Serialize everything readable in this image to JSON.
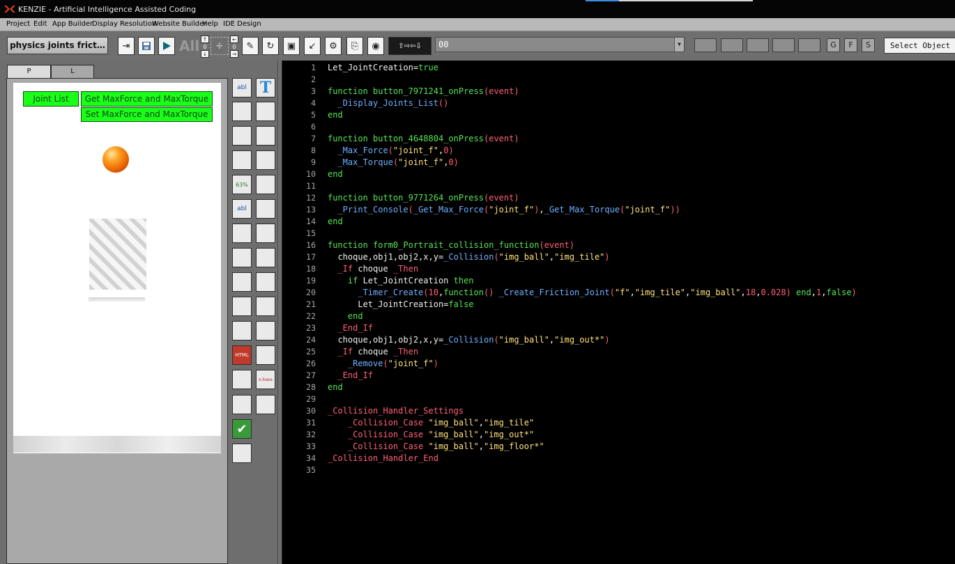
{
  "app": {
    "title": "KENZIE - Artificial Intelligence Assisted Coding"
  },
  "menu": [
    "Project",
    "Edit",
    "App Builder",
    "Display Resolution",
    "Website Builder",
    "Help",
    "IDE Design"
  ],
  "toolbar": {
    "project_button": "physics joints frict…",
    "all_label": "All",
    "mini_numbers": [
      "0",
      "0"
    ],
    "combo_value": "00",
    "letter_buttons": [
      "G",
      "F",
      "S"
    ],
    "select_object": "Select Object"
  },
  "left_panel": {
    "tabs": [
      "P",
      "L"
    ],
    "canvas_buttons": {
      "joint_list": "Joint List",
      "get_max": "Get MaxForce and MaxTorque",
      "set_max": "Set MaxForce and MaxTorque"
    },
    "palette": [
      {
        "icon": "label-icon",
        "glyph": "abl"
      },
      {
        "icon": "text-icon",
        "glyph": "T"
      },
      {
        "icon": "image-icon",
        "glyph": ""
      },
      {
        "icon": "button-icon",
        "glyph": ""
      },
      {
        "icon": "image-animation-icon",
        "glyph": ""
      },
      {
        "icon": "image-rotate-icon",
        "glyph": ""
      },
      {
        "icon": "list-icon",
        "glyph": ""
      },
      {
        "icon": "collision-icon",
        "glyph": ""
      },
      {
        "icon": "progress-icon",
        "glyph": "63%"
      },
      {
        "icon": "resize-icon",
        "glyph": ""
      },
      {
        "icon": "textbox-icon",
        "glyph": "abl"
      },
      {
        "icon": "move-icon",
        "glyph": ""
      },
      {
        "icon": "input-icon",
        "glyph": ""
      },
      {
        "icon": "shape-icon",
        "glyph": ""
      },
      {
        "icon": "slider-icon",
        "glyph": ""
      },
      {
        "icon": "joint-icon",
        "glyph": ""
      },
      {
        "icon": "particles-icon",
        "glyph": ""
      },
      {
        "icon": "physics-icon",
        "glyph": ""
      },
      {
        "icon": "spinner-icon",
        "glyph": ""
      },
      {
        "icon": "pivot-icon",
        "glyph": ""
      },
      {
        "icon": "toggle-icon",
        "glyph": ""
      },
      {
        "icon": "rope-icon",
        "glyph": ""
      },
      {
        "icon": "html-icon",
        "glyph": "HTML"
      },
      {
        "icon": "web-icon",
        "glyph": ""
      },
      {
        "icon": "map-icon",
        "glyph": ""
      },
      {
        "icon": "notes-icon",
        "glyph": "x-base"
      },
      {
        "icon": "radio-icon",
        "glyph": ""
      },
      {
        "icon": "timer-icon",
        "glyph": ""
      },
      {
        "icon": "checkbox-icon",
        "glyph": "✔"
      },
      {
        "icon": "video-icon",
        "glyph": ""
      }
    ]
  },
  "editor": {
    "lines": [
      {
        "n": "1",
        "tokens": [
          [
            "id",
            "Let_JointCreation"
          ],
          [
            "op",
            "="
          ],
          [
            "kw",
            "true"
          ]
        ]
      },
      {
        "n": "2",
        "tokens": []
      },
      {
        "n": "3",
        "tokens": [
          [
            "kw",
            "function "
          ],
          [
            "fn",
            "button_7971241_onPress"
          ],
          [
            "br",
            "("
          ],
          [
            "nm",
            "event"
          ],
          [
            "br",
            ")"
          ]
        ]
      },
      {
        "n": "4",
        "tokens": [
          [
            "op",
            "  "
          ],
          [
            "cl",
            "_Display_Joints_List"
          ],
          [
            "br",
            "()"
          ]
        ]
      },
      {
        "n": "5",
        "tokens": [
          [
            "kw",
            "end"
          ]
        ]
      },
      {
        "n": "6",
        "tokens": []
      },
      {
        "n": "7",
        "tokens": [
          [
            "kw",
            "function "
          ],
          [
            "fn",
            "button_4648804_onPress"
          ],
          [
            "br",
            "("
          ],
          [
            "nm",
            "event"
          ],
          [
            "br",
            ")"
          ]
        ]
      },
      {
        "n": "8",
        "tokens": [
          [
            "op",
            "  "
          ],
          [
            "cl",
            "_Max_Force"
          ],
          [
            "br",
            "("
          ],
          [
            "lt",
            "\"joint_f\""
          ],
          [
            "op",
            ","
          ],
          [
            "nm",
            "0"
          ],
          [
            "br",
            ")"
          ]
        ]
      },
      {
        "n": "9",
        "tokens": [
          [
            "op",
            "  "
          ],
          [
            "cl",
            "_Max_Torque"
          ],
          [
            "br",
            "("
          ],
          [
            "lt",
            "\"joint_f\""
          ],
          [
            "op",
            ","
          ],
          [
            "nm",
            "0"
          ],
          [
            "br",
            ")"
          ]
        ]
      },
      {
        "n": "10",
        "tokens": [
          [
            "kw",
            "end"
          ]
        ]
      },
      {
        "n": "11",
        "tokens": []
      },
      {
        "n": "12",
        "tokens": [
          [
            "kw",
            "function "
          ],
          [
            "fn",
            "button_9771264_onPress"
          ],
          [
            "br",
            "("
          ],
          [
            "nm",
            "event"
          ],
          [
            "br",
            ")"
          ]
        ]
      },
      {
        "n": "13",
        "tokens": [
          [
            "op",
            "  "
          ],
          [
            "cl",
            "_Print_Console"
          ],
          [
            "br",
            "("
          ],
          [
            "cl",
            "_Get_Max_Force"
          ],
          [
            "br",
            "("
          ],
          [
            "lt",
            "\"joint_f\""
          ],
          [
            "br",
            ")"
          ],
          [
            "op",
            ","
          ],
          [
            "cl",
            "_Get_Max_Torque"
          ],
          [
            "br",
            "("
          ],
          [
            "lt",
            "\"joint_f\""
          ],
          [
            "br",
            "))"
          ]
        ]
      },
      {
        "n": "14",
        "tokens": [
          [
            "kw",
            "end"
          ]
        ]
      },
      {
        "n": "15",
        "tokens": []
      },
      {
        "n": "16",
        "tokens": [
          [
            "kw",
            "function "
          ],
          [
            "fn",
            "form0_Portrait_collision_function"
          ],
          [
            "br",
            "("
          ],
          [
            "nm",
            "event"
          ],
          [
            "br",
            ")"
          ]
        ]
      },
      {
        "n": "17",
        "tokens": [
          [
            "id",
            "  choque,obj1,obj2,x,y"
          ],
          [
            "op",
            "="
          ],
          [
            "cl",
            "_Collision"
          ],
          [
            "br",
            "("
          ],
          [
            "lt",
            "\"img_ball\""
          ],
          [
            "op",
            ","
          ],
          [
            "lt",
            "\"img_tile\""
          ],
          [
            "br",
            ")"
          ]
        ]
      },
      {
        "n": "18",
        "tokens": [
          [
            "sp",
            "  _If "
          ],
          [
            "id",
            "choque "
          ],
          [
            "sp",
            "_Then"
          ]
        ]
      },
      {
        "n": "19",
        "tokens": [
          [
            "kw",
            "    if "
          ],
          [
            "id",
            "Let_JointCreation "
          ],
          [
            "kw",
            "then"
          ]
        ]
      },
      {
        "n": "20",
        "tokens": [
          [
            "op",
            "      "
          ],
          [
            "cl",
            "_Timer_Create"
          ],
          [
            "br",
            "("
          ],
          [
            "nm",
            "10"
          ],
          [
            "op",
            ","
          ],
          [
            "kw",
            "function"
          ],
          [
            "br",
            "() "
          ],
          [
            "cl",
            "_Create_Friction_Joint"
          ],
          [
            "br",
            "("
          ],
          [
            "lt",
            "\"f\""
          ],
          [
            "op",
            ","
          ],
          [
            "lt",
            "\"img_tile\""
          ],
          [
            "op",
            ","
          ],
          [
            "lt",
            "\"img_ball\""
          ],
          [
            "op",
            ","
          ],
          [
            "nm",
            "18"
          ],
          [
            "op",
            ","
          ],
          [
            "nm",
            "0.028"
          ],
          [
            "br",
            ") "
          ],
          [
            "kw",
            "end"
          ],
          [
            "op",
            ","
          ],
          [
            "nm",
            "1"
          ],
          [
            "op",
            ","
          ],
          [
            "kw",
            "false"
          ],
          [
            "br",
            ")"
          ]
        ]
      },
      {
        "n": "21",
        "tokens": [
          [
            "id",
            "      Let_JointCreation"
          ],
          [
            "op",
            "="
          ],
          [
            "kw",
            "false"
          ]
        ]
      },
      {
        "n": "22",
        "tokens": [
          [
            "kw",
            "    end"
          ]
        ]
      },
      {
        "n": "23",
        "tokens": [
          [
            "sp",
            "  _End_If"
          ]
        ]
      },
      {
        "n": "24",
        "tokens": [
          [
            "id",
            "  choque,obj1,obj2,x,y"
          ],
          [
            "op",
            "="
          ],
          [
            "cl",
            "_Collision"
          ],
          [
            "br",
            "("
          ],
          [
            "lt",
            "\"img_ball\""
          ],
          [
            "op",
            ","
          ],
          [
            "lt",
            "\"img_out*\""
          ],
          [
            "br",
            ")"
          ]
        ]
      },
      {
        "n": "25",
        "tokens": [
          [
            "sp",
            "  _If "
          ],
          [
            "id",
            "choque "
          ],
          [
            "sp",
            "_Then"
          ]
        ]
      },
      {
        "n": "26",
        "tokens": [
          [
            "op",
            "    "
          ],
          [
            "cl",
            "_Remove"
          ],
          [
            "br",
            "("
          ],
          [
            "lt",
            "\"joint_f\""
          ],
          [
            "br",
            ")"
          ]
        ]
      },
      {
        "n": "27",
        "tokens": [
          [
            "sp",
            "  _End_If"
          ]
        ]
      },
      {
        "n": "28",
        "tokens": [
          [
            "kw",
            "end"
          ]
        ]
      },
      {
        "n": "29",
        "tokens": []
      },
      {
        "n": "30",
        "tokens": [
          [
            "sp",
            "_Collision_Handler_Settings"
          ]
        ]
      },
      {
        "n": "31",
        "tokens": [
          [
            "sp",
            "    _Collision_Case "
          ],
          [
            "lt",
            "\"img_ball\""
          ],
          [
            "op",
            ","
          ],
          [
            "lt",
            "\"img_tile\""
          ]
        ]
      },
      {
        "n": "32",
        "tokens": [
          [
            "sp",
            "    _Collision_Case "
          ],
          [
            "lt",
            "\"img_ball\""
          ],
          [
            "op",
            ","
          ],
          [
            "lt",
            "\"img_out*\""
          ]
        ]
      },
      {
        "n": "33",
        "tokens": [
          [
            "sp",
            "    _Collision_Case "
          ],
          [
            "lt",
            "\"img_ball\""
          ],
          [
            "op",
            ","
          ],
          [
            "lt",
            "\"img_floor*\""
          ]
        ]
      },
      {
        "n": "34",
        "tokens": [
          [
            "sp",
            "_Collision_Handler_End"
          ]
        ]
      },
      {
        "n": "35",
        "tokens": []
      }
    ]
  }
}
